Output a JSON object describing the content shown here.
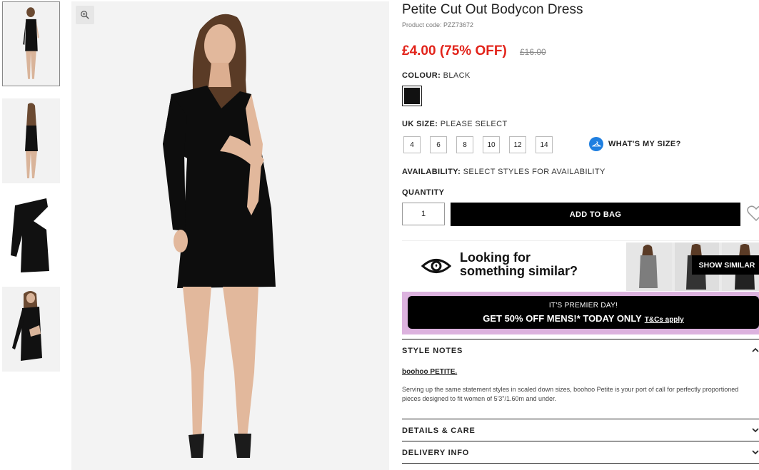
{
  "product": {
    "title": "Petite Cut Out Bodycon Dress",
    "product_code": "Product code: PZZ73672",
    "price": "£4.00 (75% OFF)",
    "old_price": "£16.00"
  },
  "colour": {
    "label": "COLOUR:",
    "value": "BLACK",
    "swatch_color": "#111111"
  },
  "size": {
    "label": "UK SIZE:",
    "value": "PLEASE SELECT",
    "options": [
      "4",
      "6",
      "8",
      "10",
      "12",
      "14"
    ],
    "whats_my_size": "WHAT'S MY SIZE?"
  },
  "availability": {
    "label": "AVAILABILITY:",
    "value": "SELECT STYLES FOR AVAILABILITY"
  },
  "quantity": {
    "label": "QUANTITY",
    "value": "1"
  },
  "add_to_bag": "ADD TO BAG",
  "similar": {
    "line1": "Looking for",
    "line2": "something similar?",
    "button": "SHOW SIMILAR"
  },
  "promo": {
    "small": "IT'S PREMIER DAY!",
    "big": "GET 50% OFF MENS!* TODAY ONLY",
    "link": "T&Cs apply",
    "bg_color": "#dcb2de"
  },
  "style_notes": {
    "heading": "STYLE NOTES",
    "brand": "boohoo PETITE.",
    "body": "Serving up the same statement styles in scaled down sizes, boohoo Petite is your port of call for perfectly proportioned pieces designed to fit women of 5'3\"/1.60m and under."
  },
  "details_care": {
    "heading": "DETAILS & CARE"
  },
  "delivery_info": {
    "heading": "DELIVERY INFO"
  },
  "colors": {
    "price_red": "#e2231a",
    "accent_blue": "#1f7fe0"
  }
}
